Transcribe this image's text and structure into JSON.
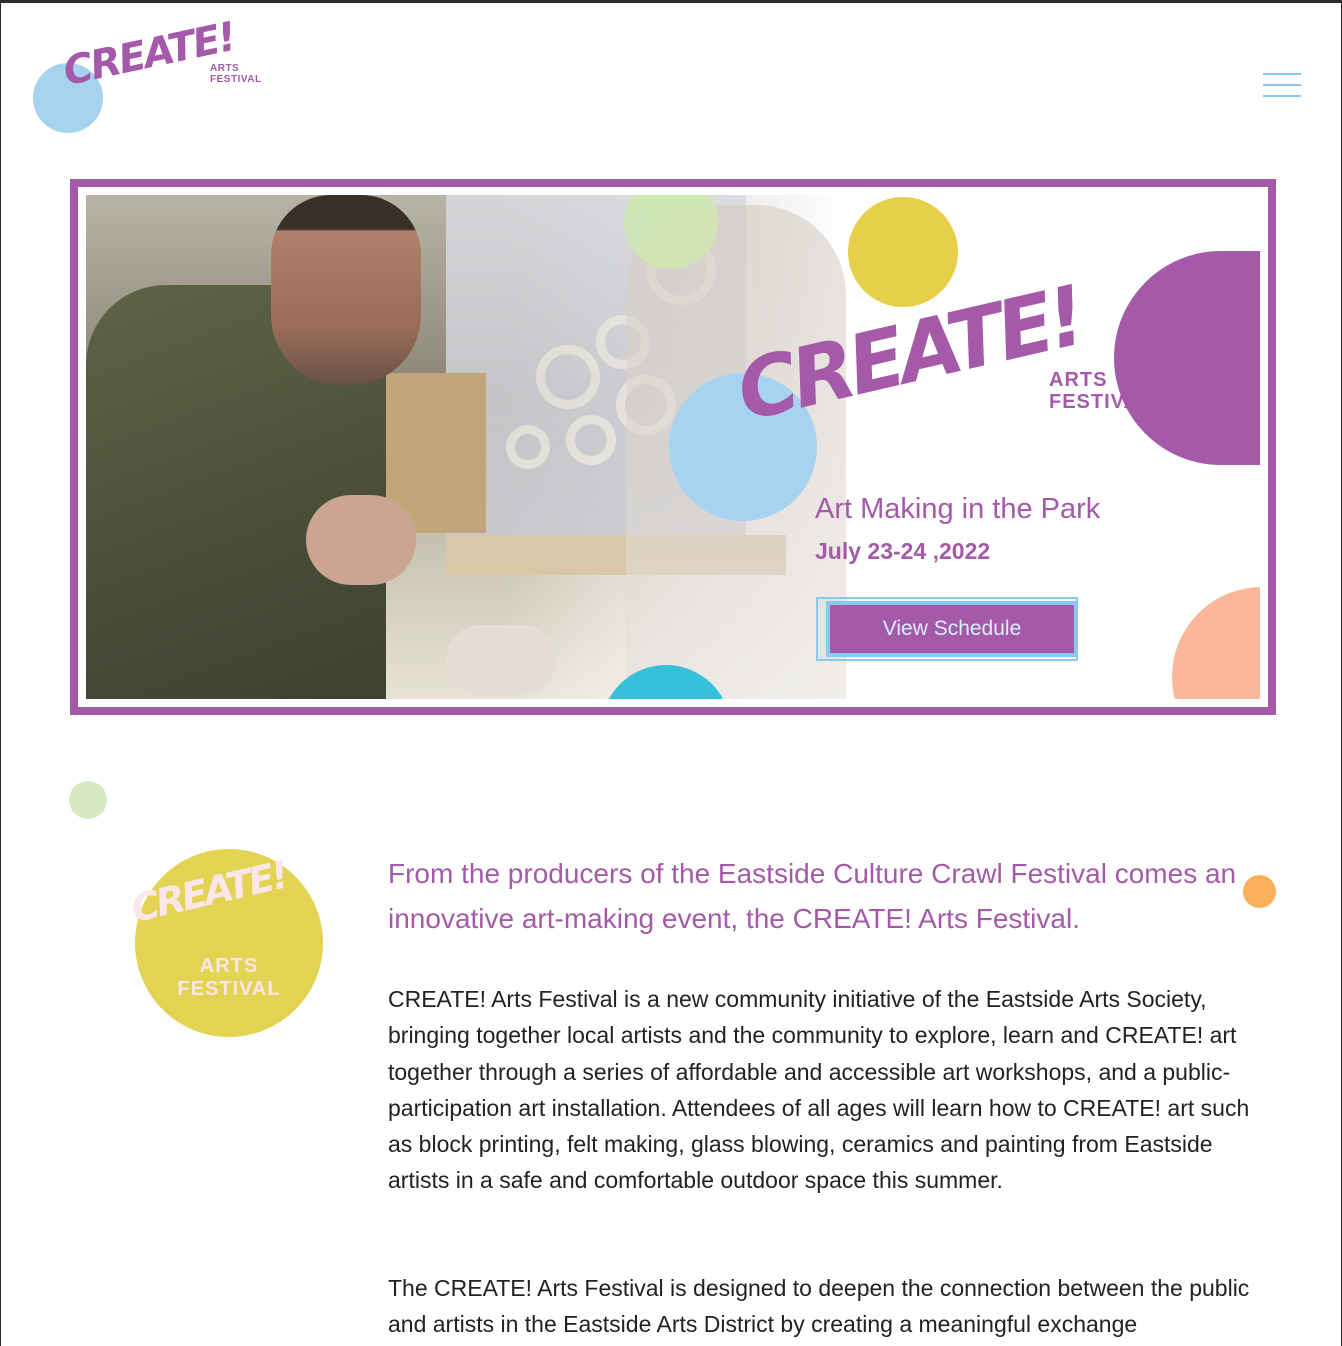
{
  "header": {
    "logo_word": "CREATE!",
    "logo_sub": "ARTS FESTIVAL",
    "menu_icon": "hamburger-menu-icon"
  },
  "hero": {
    "brand_word": "CREATE!",
    "brand_sub": "ARTS FESTIVAL",
    "subtitle": "Art Making in the Park",
    "date": "July 23-24 ,2022",
    "cta_label": "View Schedule"
  },
  "intro": {
    "badge_word": "CREATE!",
    "badge_sub": "ARTS FESTIVAL",
    "heading": "From the producers of the Eastside Culture Crawl Festival comes an innovative art-making event, the CREATE! Arts Festival.",
    "paragraph_1": "CREATE! Arts Festival is a new community initiative of the Eastside Arts Society, bringing together local artists and the community to explore, learn and CREATE! art together through a series of affordable and accessible art workshops, and a public-participation art installation. Attendees of all ages will learn how to CREATE! art such as block printing, felt making, glass blowing, ceramics and painting from Eastside artists in a safe and comfortable outdoor space this summer.",
    "paragraph_2": "The CREATE! Arts Festival is designed to deepen the connection between the public and artists in the Eastside Arts District by creating a meaningful exchange"
  },
  "colors": {
    "brand_purple": "#a45aa8",
    "sky_blue": "#a7d2f0",
    "mustard": "#e3d353",
    "peach": "#fbb79a",
    "cyan": "#37c0da",
    "orange": "#fbb05a",
    "sage": "#d8e8c2"
  }
}
